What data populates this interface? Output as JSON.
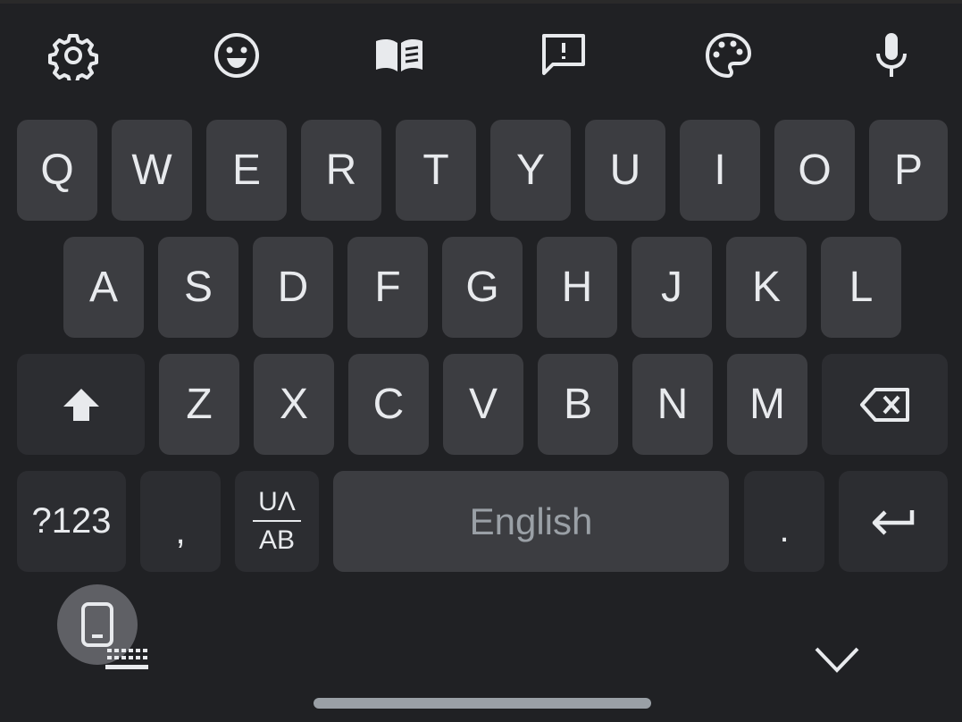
{
  "toolbar": {
    "icons": [
      "gear-icon",
      "smiley-icon",
      "open-book-icon",
      "feedback-icon",
      "palette-icon",
      "microphone-icon"
    ]
  },
  "rows": {
    "row1": [
      "Q",
      "W",
      "E",
      "R",
      "T",
      "Y",
      "U",
      "I",
      "O",
      "P"
    ],
    "row2": [
      "A",
      "S",
      "D",
      "F",
      "G",
      "H",
      "J",
      "K",
      "L"
    ],
    "row3": [
      "Z",
      "X",
      "C",
      "V",
      "B",
      "N",
      "M"
    ]
  },
  "bottom": {
    "symbols_label": "?123",
    "comma_label": ",",
    "translit_top": "UΛ",
    "translit_bottom": "AB",
    "space_label": "English",
    "period_label": "."
  },
  "colors": {
    "background": "#202124",
    "key": "#3c3d41",
    "function_key": "#2c2d31",
    "text": "#e8eaed",
    "space_text": "#9aa0a6"
  }
}
